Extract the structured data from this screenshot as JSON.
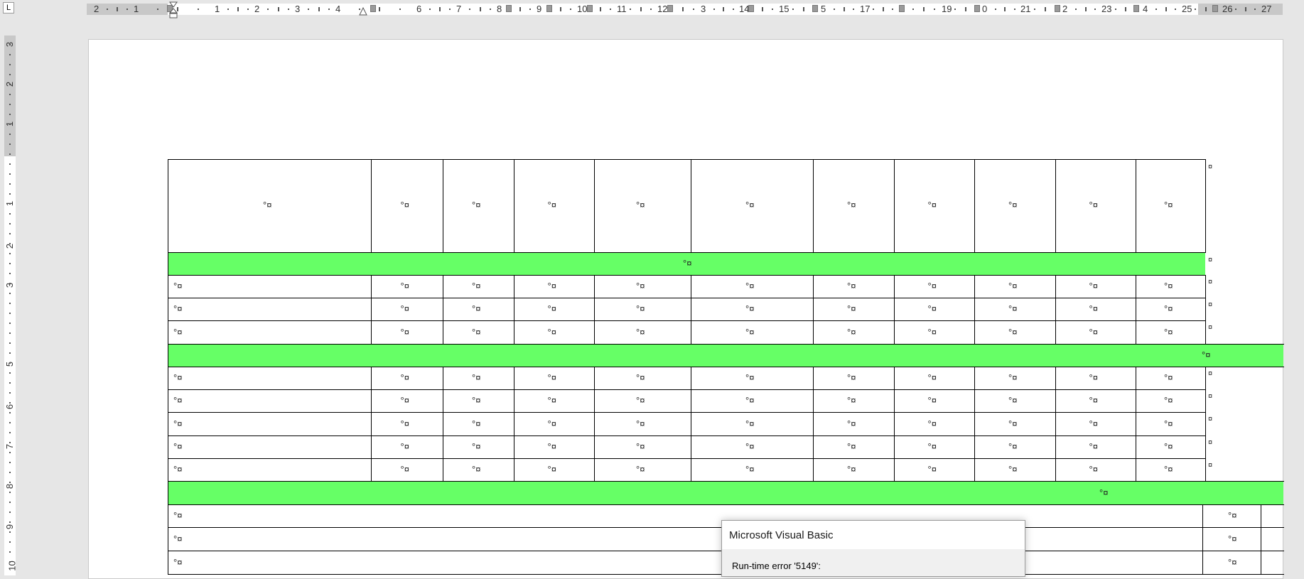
{
  "horizontal_ruler": {
    "labels": [
      "2",
      "1",
      "1",
      "2",
      "3",
      "4",
      "6",
      "7",
      "8",
      "9",
      "10",
      "11",
      "12",
      "3",
      "14",
      "15",
      "5",
      "17",
      "3",
      "19",
      "0",
      "21",
      "2",
      "23",
      "4",
      "25",
      "26",
      "27"
    ]
  },
  "vertical_ruler": {
    "labels": [
      "3",
      "2",
      "1",
      "1",
      "2",
      "3",
      "5",
      "6",
      "7",
      "8",
      "9",
      "10"
    ]
  },
  "table": {
    "cell_mark": "°¤",
    "end_mark": "¤",
    "columns": 11,
    "row_groups": [
      "header",
      "green",
      "data",
      "data",
      "data",
      "green",
      "data",
      "data",
      "data",
      "data",
      "data",
      "green",
      "wide",
      "wide",
      "wide"
    ]
  },
  "colors": {
    "highlight_green": "#66ff66",
    "page_background": "#ffffff",
    "app_background": "#e6e6e6"
  },
  "dialog": {
    "title": "Microsoft Visual Basic",
    "message": "Run-time error '5149':"
  }
}
